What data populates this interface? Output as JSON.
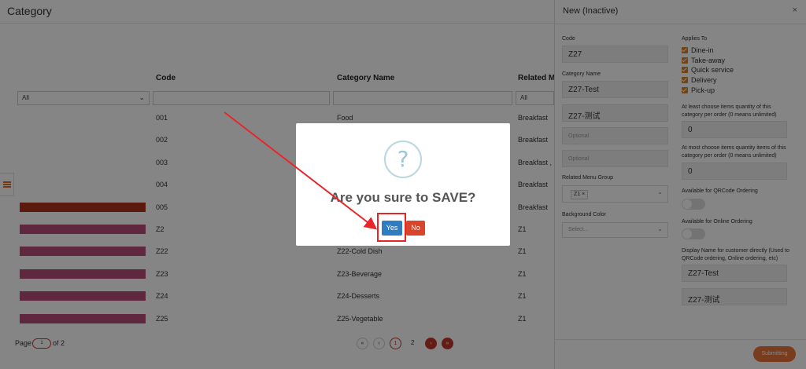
{
  "page": {
    "title": "Category",
    "columns": {
      "code": "Code",
      "category_name": "Category Name",
      "related_menu": "Related Me"
    },
    "filters": {
      "first": "All",
      "related": "All"
    },
    "rows": [
      {
        "code": "001",
        "name": "Food",
        "menu": "Breakfast",
        "color": ""
      },
      {
        "code": "002",
        "name": "",
        "menu": "Breakfast",
        "color": ""
      },
      {
        "code": "003",
        "name": "",
        "menu": "Breakfast , I",
        "color": ""
      },
      {
        "code": "004",
        "name": "",
        "menu": "Breakfast",
        "color": ""
      },
      {
        "code": "005",
        "name": "",
        "menu": "Breakfast",
        "color": "#b0301a"
      },
      {
        "code": "Z2",
        "name": "",
        "menu": "Z1",
        "color": "#b84d77"
      },
      {
        "code": "Z22",
        "name": "Z22-Cold Dish",
        "menu": "Z1",
        "color": "#b84d77"
      },
      {
        "code": "Z23",
        "name": "Z23-Beverage",
        "menu": "Z1",
        "color": "#b84d77"
      },
      {
        "code": "Z24",
        "name": "Z24-Desserts",
        "menu": "Z1",
        "color": "#b84d77"
      },
      {
        "code": "Z25",
        "name": "Z25-Vegetable",
        "menu": "Z1",
        "color": "#b84d77"
      }
    ],
    "pager": {
      "label": "Page",
      "current": "1",
      "of": "of 2",
      "page1": "1",
      "page2": "2"
    }
  },
  "panel": {
    "title": "New (Inactive)",
    "close": "×",
    "code_label": "Code",
    "code_value": "Z27",
    "category_name_label": "Category Name",
    "category_name_value": "Z27-Test",
    "category_name_alt": "Z27-测试",
    "optional_1": "Optional",
    "optional_2": "Optional",
    "related_menu_label": "Related Menu Group",
    "related_menu_tag": "Z1",
    "background_color_label": "Background Color",
    "background_color_placeholder": "Select...",
    "applies_to_label": "Applies To",
    "applies_to": [
      "Dine-in",
      "Take-away",
      "Quick service",
      "Delivery",
      "Pick-up"
    ],
    "min_qty_label": "At least choose items quantity of this category per order (0 means unlimited)",
    "min_qty_value": "0",
    "max_qty_label": "At most choose items quantity items of this category per order (0 means unlimited)",
    "max_qty_value": "0",
    "qr_label": "Available for QRCode Ordering",
    "online_label": "Available for Online Ordering",
    "display_name_label": "Display Name for customer directly (Used to QRCode ordering, Online ordering, etc)",
    "display_name_value": "Z27-Test",
    "display_name_alt": "Z27-测试",
    "submit_label": "Submitting"
  },
  "modal": {
    "icon": "?",
    "message": "Are you sure to SAVE?",
    "yes": "Yes",
    "no": "No"
  },
  "colors": {
    "accent": "#e8743b",
    "primary": "#2f7cc2",
    "danger": "#d9452b",
    "highlight": "#e8262a"
  }
}
